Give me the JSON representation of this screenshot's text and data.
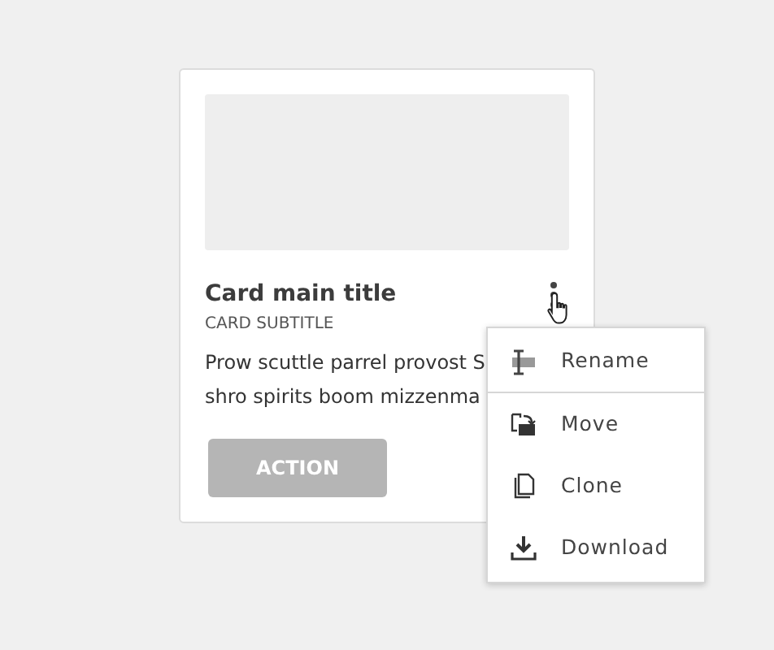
{
  "card": {
    "title": "Card main title",
    "subtitle": "CARD SUBTITLE",
    "text_lines": [
      "Prow scuttle parrel provost S",
      "shro spirits boom mizzenma"
    ],
    "action": {
      "label": "ACTION",
      "disabled": true
    }
  },
  "menu": {
    "items": [
      {
        "kind": "rename",
        "label": "Rename",
        "divider_after": true
      },
      {
        "kind": "move",
        "label": "Move",
        "divider_after": false
      },
      {
        "kind": "clone",
        "label": "Clone",
        "divider_after": false
      },
      {
        "kind": "download",
        "label": "Download",
        "divider_after": false
      }
    ]
  }
}
